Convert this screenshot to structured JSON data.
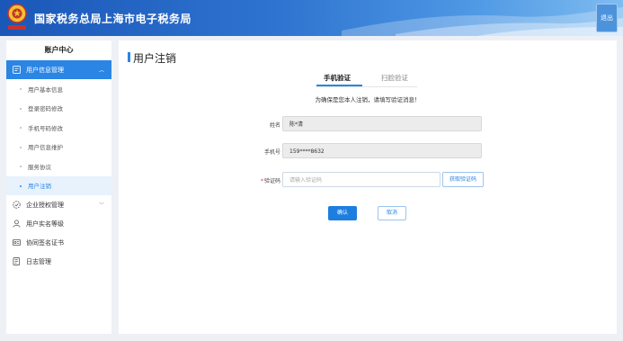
{
  "header": {
    "site_title": "国家税务总局上海市电子税务局",
    "exit_label": "退出",
    "emblem_icon": "tax-emblem-icon",
    "accent_color": "#2b85e4"
  },
  "sidebar": {
    "title": "账户中心",
    "groups": [
      {
        "label": "用户信息管理",
        "icon": "user-info-icon",
        "expanded": true,
        "items": [
          {
            "label": "用户基本信息"
          },
          {
            "label": "登录密码修改"
          },
          {
            "label": "手机号码修改"
          },
          {
            "label": "用户信息维护"
          },
          {
            "label": "服务协议"
          },
          {
            "label": "用户注销"
          }
        ]
      },
      {
        "label": "企业授权管理",
        "icon": "authorization-icon"
      },
      {
        "label": "用户实名等级",
        "icon": "user-icon"
      },
      {
        "label": "协同签名证书",
        "icon": "certificate-icon"
      },
      {
        "label": "日志管理",
        "icon": "log-icon"
      }
    ]
  },
  "main": {
    "title": "用户注销",
    "tabs": [
      {
        "label": "手机验证",
        "active": true
      },
      {
        "label": "扫脸验证",
        "active": false
      }
    ],
    "notice": "为确保是您本人注销，请填写验证消息！",
    "form": {
      "name_label": "姓名",
      "name_value": "陈*清",
      "phone_label": "手机号",
      "phone_value": "159****8632",
      "code_required_mark": "*",
      "code_label": "验证码",
      "code_placeholder": "请输入验证码",
      "get_code_label": "获取验证码"
    },
    "confirm_label": "确认",
    "cancel_label": "取消"
  }
}
